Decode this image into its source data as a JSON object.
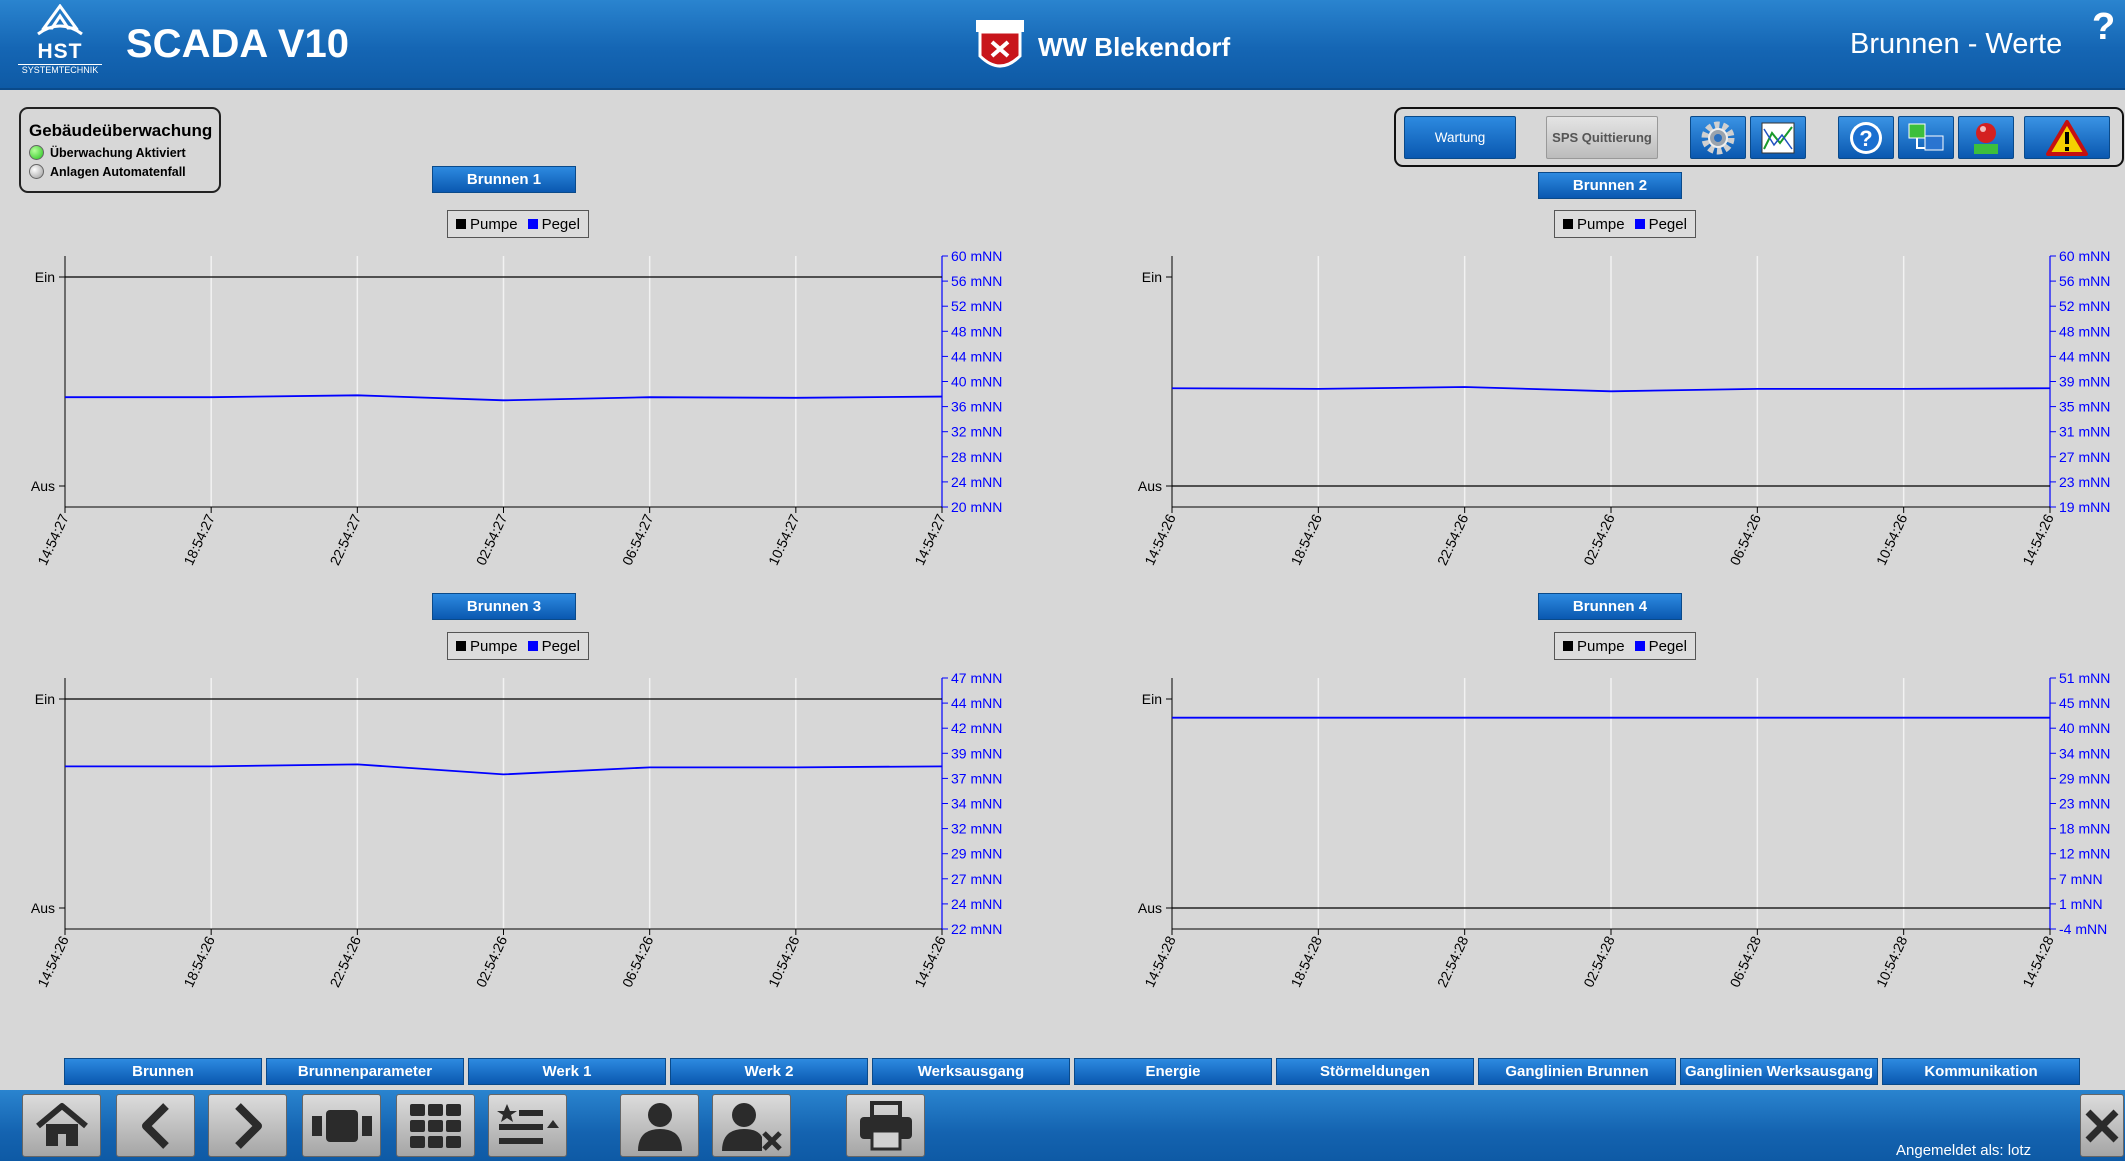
{
  "header": {
    "logo_text": "HST",
    "logo_sub": "SYSTEMTECHNIK",
    "app_title": "SCADA V10",
    "site_title": "WW Blekendorf",
    "page_title": "Brunnen - Werte",
    "help_label": "?"
  },
  "monitor": {
    "title": "Gebäudeüberwachung",
    "items": [
      {
        "label": "Überwachung Aktiviert",
        "status": "green"
      },
      {
        "label": "Anlagen Automatenfall",
        "status": "grey"
      }
    ]
  },
  "toolbar": {
    "wartung_label": "Wartung",
    "sps_label": "SPS Quittierung",
    "icons": [
      "gear-icon",
      "trend-chart-icon",
      "help-icon",
      "network-icon",
      "alarm-bell-icon",
      "warning-icon"
    ]
  },
  "charts": [
    {
      "title": "Brunnen 1",
      "legend": [
        "Pumpe",
        "Pegel"
      ],
      "pump_labels": [
        "Ein",
        "Aus"
      ],
      "y_ticks": [
        "60 mNN",
        "56 mNN",
        "52 mNN",
        "48 mNN",
        "44 mNN",
        "40 mNN",
        "36 mNN",
        "32 mNN",
        "28 mNN",
        "24 mNN",
        "20 mNN"
      ],
      "x_ticks": [
        "14:54:27",
        "18:54:27",
        "22:54:27",
        "02:54:27",
        "06:54:27",
        "10:54:27",
        "14:54:27"
      ]
    },
    {
      "title": "Brunnen 2",
      "legend": [
        "Pumpe",
        "Pegel"
      ],
      "pump_labels": [
        "Ein",
        "Aus"
      ],
      "y_ticks": [
        "60 mNN",
        "56 mNN",
        "52 mNN",
        "48 mNN",
        "44 mNN",
        "39 mNN",
        "35 mNN",
        "31 mNN",
        "27 mNN",
        "23 mNN",
        "19 mNN"
      ],
      "x_ticks": [
        "14:54:26",
        "18:54:26",
        "22:54:26",
        "02:54:26",
        "06:54:26",
        "10:54:26",
        "14:54:26"
      ]
    },
    {
      "title": "Brunnen 3",
      "legend": [
        "Pumpe",
        "Pegel"
      ],
      "pump_labels": [
        "Ein",
        "Aus"
      ],
      "y_ticks": [
        "47 mNN",
        "44 mNN",
        "42 mNN",
        "39 mNN",
        "37 mNN",
        "34 mNN",
        "32 mNN",
        "29 mNN",
        "27 mNN",
        "24 mNN",
        "22 mNN"
      ],
      "x_ticks": [
        "14:54:26",
        "18:54:26",
        "22:54:26",
        "02:54:26",
        "06:54:26",
        "10:54:26",
        "14:54:26"
      ]
    },
    {
      "title": "Brunnen 4",
      "legend": [
        "Pumpe",
        "Pegel"
      ],
      "pump_labels": [
        "Ein",
        "Aus"
      ],
      "y_ticks": [
        "51 mNN",
        "45 mNN",
        "40 mNN",
        "34 mNN",
        "29 mNN",
        "23 mNN",
        "18 mNN",
        "12 mNN",
        "7 mNN",
        "1 mNN",
        "-4 mNN"
      ],
      "x_ticks": [
        "14:54:28",
        "18:54:28",
        "22:54:28",
        "02:54:28",
        "06:54:28",
        "10:54:28",
        "14:54:28"
      ]
    }
  ],
  "chart_data": [
    {
      "type": "line",
      "title": "Brunnen 1",
      "ylabel": "mNN",
      "ylim": [
        20,
        60
      ],
      "x": [
        "14:54:27",
        "18:54:27",
        "22:54:27",
        "02:54:27",
        "06:54:27",
        "10:54:27",
        "14:54:27"
      ],
      "series": [
        {
          "name": "Pumpe",
          "color": "#000000",
          "values": [
            "Ein",
            "Ein",
            "Ein",
            "Ein",
            "Ein",
            "Ein",
            "Ein"
          ]
        },
        {
          "name": "Pegel",
          "color": "#0000ff",
          "values": [
            37.5,
            37.5,
            37.8,
            37.0,
            37.5,
            37.4,
            37.6
          ]
        }
      ]
    },
    {
      "type": "line",
      "title": "Brunnen 2",
      "ylabel": "mNN",
      "ylim": [
        19,
        60
      ],
      "x": [
        "14:54:26",
        "18:54:26",
        "22:54:26",
        "02:54:26",
        "06:54:26",
        "10:54:26",
        "14:54:26"
      ],
      "series": [
        {
          "name": "Pumpe",
          "color": "#000000",
          "values": [
            "Aus",
            "Aus",
            "Aus",
            "Aus",
            "Aus",
            "Aus",
            "Aus"
          ]
        },
        {
          "name": "Pegel",
          "color": "#0000ff",
          "values": [
            38.4,
            38.3,
            38.6,
            37.9,
            38.3,
            38.3,
            38.4
          ]
        }
      ]
    },
    {
      "type": "line",
      "title": "Brunnen 3",
      "ylabel": "mNN",
      "ylim": [
        22,
        47
      ],
      "x": [
        "14:54:26",
        "18:54:26",
        "22:54:26",
        "02:54:26",
        "06:54:26",
        "10:54:26",
        "14:54:26"
      ],
      "series": [
        {
          "name": "Pumpe",
          "color": "#000000",
          "values": [
            "Ein",
            "Ein",
            "Ein",
            "Ein",
            "Ein",
            "Ein",
            "Ein"
          ]
        },
        {
          "name": "Pegel",
          "color": "#0000ff",
          "values": [
            38.2,
            38.2,
            38.4,
            37.4,
            38.1,
            38.1,
            38.2
          ]
        }
      ]
    },
    {
      "type": "line",
      "title": "Brunnen 4",
      "ylabel": "mNN",
      "ylim": [
        -4,
        51
      ],
      "x": [
        "14:54:28",
        "18:54:28",
        "22:54:28",
        "02:54:28",
        "06:54:28",
        "10:54:28",
        "14:54:28"
      ],
      "series": [
        {
          "name": "Pumpe",
          "color": "#000000",
          "values": [
            "Aus",
            "Aus",
            "Aus",
            "Aus",
            "Aus",
            "Aus",
            "Aus"
          ]
        },
        {
          "name": "Pegel",
          "color": "#0000ff",
          "values": [
            42.3,
            42.3,
            42.3,
            42.3,
            42.3,
            42.3,
            42.3
          ]
        }
      ]
    }
  ],
  "nav": [
    "Brunnen",
    "Brunnenparameter",
    "Werk 1",
    "Werk 2",
    "Werksausgang",
    "Energie",
    "Störmeldungen",
    "Ganglinien Brunnen",
    "Ganglinien Werksausgang",
    "Kommunikation"
  ],
  "footer": {
    "buttons": [
      "home-icon",
      "back-icon",
      "forward-icon",
      "screen-icon",
      "grid-icon",
      "favorites-icon",
      "user-icon",
      "user-logout-icon",
      "print-icon"
    ],
    "login_text": "Angemeldet als: lotz",
    "close_icon": "close-icon"
  }
}
